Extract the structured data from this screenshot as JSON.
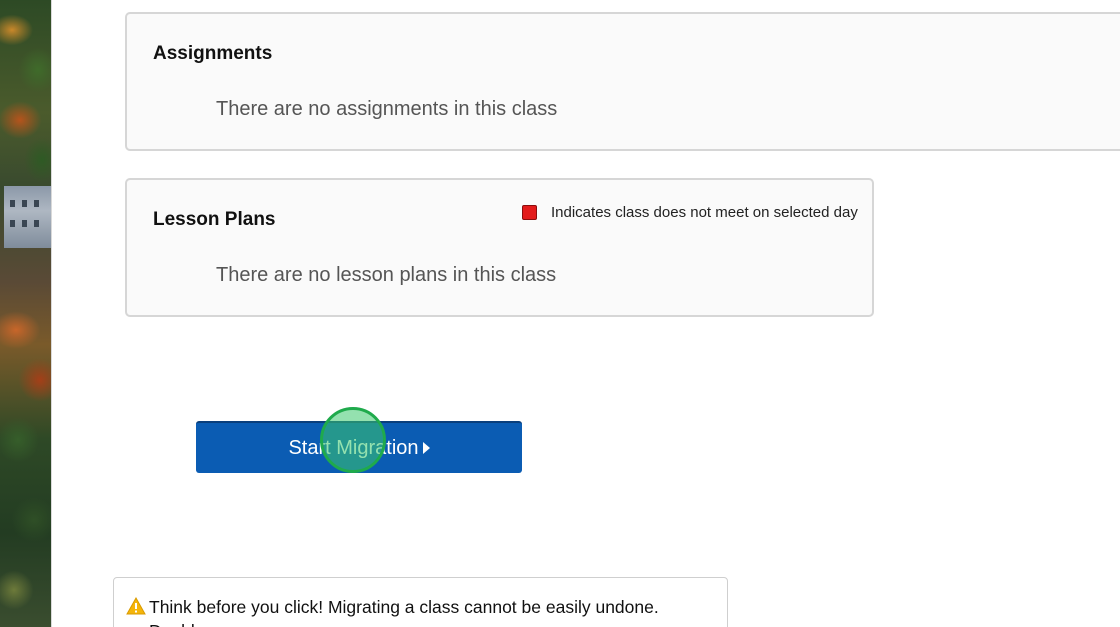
{
  "assignments": {
    "title": "Assignments",
    "empty_message": "There are no assignments in this class"
  },
  "lesson_plans": {
    "title": "Lesson Plans",
    "legend_label": "Indicates class does not meet on selected day",
    "legend_color": "#e31b1b",
    "empty_message": "There are no lesson plans in this class"
  },
  "migration": {
    "button_label": "Start Migration",
    "button_icon": "caret-right-icon",
    "button_color": "#0b5cb3"
  },
  "warning": {
    "icon": "warning-icon",
    "text": "Think before you click! Migrating a class cannot be easily undone. Double"
  }
}
